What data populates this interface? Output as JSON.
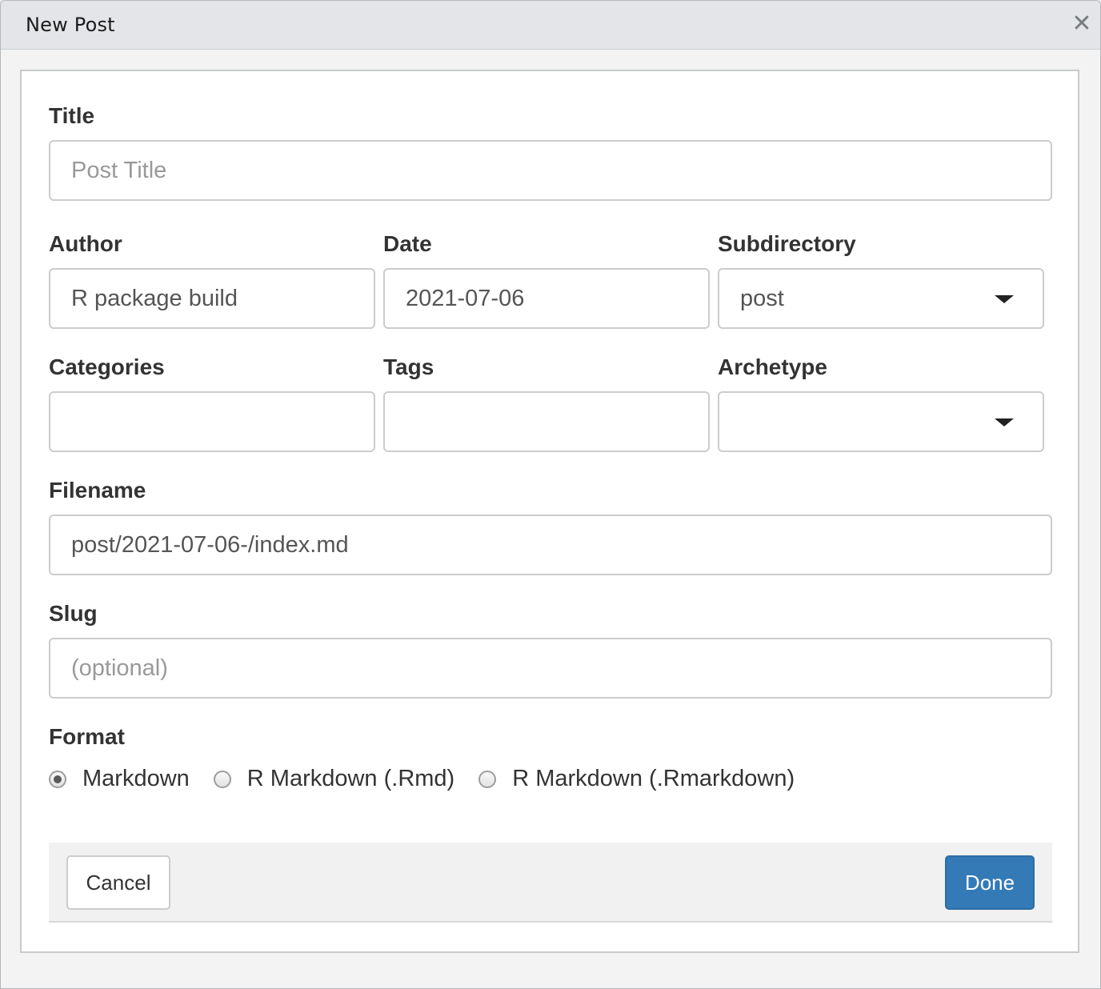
{
  "window": {
    "title": "New Post",
    "close_glyph": "✕"
  },
  "form": {
    "title": {
      "label": "Title",
      "value": "",
      "placeholder": "Post Title"
    },
    "author": {
      "label": "Author",
      "value": "R package build"
    },
    "date": {
      "label": "Date",
      "value": "2021-07-06"
    },
    "subdirectory": {
      "label": "Subdirectory",
      "value": "post"
    },
    "categories": {
      "label": "Categories",
      "value": ""
    },
    "tags": {
      "label": "Tags",
      "value": ""
    },
    "archetype": {
      "label": "Archetype",
      "value": ""
    },
    "filename": {
      "label": "Filename",
      "value": "post/2021-07-06-/index.md"
    },
    "slug": {
      "label": "Slug",
      "value": "",
      "placeholder": "(optional)"
    },
    "format": {
      "label": "Format",
      "options": [
        "Markdown",
        "R Markdown (.Rmd)",
        "R Markdown (.Rmarkdown)"
      ],
      "selected": "Markdown"
    }
  },
  "footer": {
    "cancel_label": "Cancel",
    "done_label": "Done"
  },
  "colors": {
    "primary_button": "#337ab7",
    "border": "#cccccc",
    "label_text": "#333333"
  },
  "icons": {
    "close": "close-icon",
    "dropdown": "caret-down-icon"
  }
}
